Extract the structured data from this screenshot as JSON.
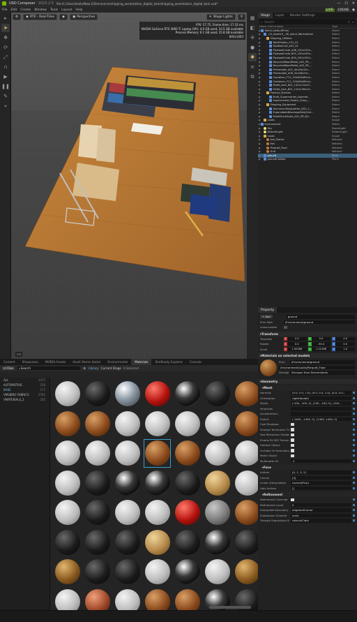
{
  "app": {
    "name": "USD Composer",
    "version": "2023.2.5",
    "file_path": "file:/C:/Users/kallu/New E/Omniverse/shipping_workstation_digital_twin/shipping_workstation_digital_twin.usd*"
  },
  "menu": [
    "File",
    "Edit",
    "Create",
    "Window",
    "Tools",
    "Layout",
    "Help"
  ],
  "menu_status": {
    "live": "LIVE",
    "cache": "CACHE"
  },
  "viewport": {
    "renderer_label": "RTX - Real-Time",
    "camera_label": "Perspective",
    "stage_lights_label": "Stage Lights",
    "hud": [
      "FPS: 57.75, Frame time: 17.32 ms",
      "NVIDIA GeForce RTX 3060 Ti Laptop GPU: 4.6 GB used, 10.5 GB available",
      "Process Memory: 6.1 GB used, 15.8 GB available",
      "843x1403"
    ],
    "footer": "cm"
  },
  "stage": {
    "tabs": [
      "Stage",
      "Layer",
      "Render Settings"
    ],
    "search_placeholder": "Search",
    "columns": [
      "Name (Old to New)",
      "Type"
    ],
    "tree": [
      {
        "name": "World (defaultPrim)",
        "type": "Xform",
        "depth": 0,
        "icon": "xform"
      },
      {
        "name": "_CS_Assets3__5K_stand_Workstation",
        "type": "Xform",
        "depth": 1,
        "icon": "xform"
      },
      {
        "name": "Shipping_Utilities",
        "type": "Xform",
        "depth": 2,
        "icon": "folder"
      },
      {
        "name": "TableTrolley_C01_51",
        "type": "Xform",
        "depth": 3,
        "icon": "xform"
      },
      {
        "name": "ToolBoxCart_A02_51",
        "type": "Xform",
        "depth": 3,
        "icon": "xform"
      },
      {
        "name": "PlywoodCrate_A08_120x120x...",
        "type": "Xform",
        "depth": 3,
        "icon": "xform"
      },
      {
        "name": "PlywoodCrate_B01_100x100x...",
        "type": "Xform",
        "depth": 3,
        "icon": "xform"
      },
      {
        "name": "PlywoodCrate_B04_200x100x...",
        "type": "Xform",
        "depth": 3,
        "icon": "xform"
      },
      {
        "name": "RecycledWoodPallet_A02_PR_...",
        "type": "Xform",
        "depth": 3,
        "icon": "xform"
      },
      {
        "name": "RecycledWoodPallet_A02_PR_...",
        "type": "Xform",
        "depth": 3,
        "icon": "xform"
      },
      {
        "name": "Printerable_A02_40x40x30c...",
        "type": "Xform",
        "depth": 3,
        "icon": "xform"
      },
      {
        "name": "Printerable_A06_32x28x20c...",
        "type": "Xform",
        "depth": 3,
        "icon": "xform"
      },
      {
        "name": "Container_F12_120x80x85cm...",
        "type": "Xform",
        "depth": 3,
        "icon": "xform"
      },
      {
        "name": "Container_F12_120x80x85cm...",
        "type": "Xform",
        "depth": 3,
        "icon": "xform"
      },
      {
        "name": "Pallet_Asm_B01_132x112x47...",
        "type": "Xform",
        "depth": 3,
        "icon": "xform"
      },
      {
        "name": "Pallet_Asm_B01_110x136x15...",
        "type": "Xform",
        "depth": 3,
        "icon": "xform"
      },
      {
        "name": "Product_Shelves",
        "type": "Xform",
        "depth": 2,
        "icon": "folder"
      },
      {
        "name": "Multi_Supermarket_Assemb...",
        "type": "Xform",
        "depth": 3,
        "icon": "xform"
      },
      {
        "name": "Supermarket_Potato_Chips_...",
        "type": "Xform",
        "depth": 3,
        "icon": "xform"
      },
      {
        "name": "Shipping_Equipment",
        "type": "Xform",
        "depth": 2,
        "icon": "folder"
      },
      {
        "name": "AluminumStepLadder_D02_1...",
        "type": "Xform",
        "depth": 3,
        "icon": "xform"
      },
      {
        "name": "ExpandableBeverageDollyCart...",
        "type": "Xform",
        "depth": 3,
        "icon": "xform"
      },
      {
        "name": "PalletTruckScale_A01_PR_NV...",
        "type": "Xform",
        "depth": 3,
        "icon": "xform"
      },
      {
        "name": "Looks",
        "type": "Scope",
        "depth": 1,
        "icon": "folder"
      },
      {
        "name": "Environment",
        "type": "Xform",
        "depth": 0,
        "icon": "xform"
      },
      {
        "name": "Sky",
        "type": "DomeLight",
        "depth": 1,
        "icon": "light"
      },
      {
        "name": "DistantLight",
        "type": "DistantLight",
        "depth": 1,
        "icon": "light"
      },
      {
        "name": "Looks",
        "type": "Scope",
        "depth": 1,
        "icon": "folder"
      },
      {
        "name": "Ash_Planks",
        "type": "Material",
        "depth": 2,
        "icon": "material"
      },
      {
        "name": "Fab",
        "type": "Material",
        "depth": 2,
        "icon": "material"
      },
      {
        "name": "Parquet_Floor",
        "type": "Material",
        "depth": 2,
        "icon": "material"
      },
      {
        "name": "Grid",
        "type": "Material",
        "depth": 2,
        "icon": "material"
      },
      {
        "name": "ground",
        "type": "Mesh",
        "depth": 1,
        "icon": "xform",
        "selected": true
      },
      {
        "name": "groundCollider",
        "type": "Plane",
        "depth": 1,
        "icon": "xform"
      }
    ]
  },
  "property": {
    "tab": "Property",
    "add_label": "Add",
    "name_value": "ground",
    "prim_path_label": "Prim Path",
    "prim_path": "/Environment/ground",
    "instanceable_label": "Instanceable",
    "transform": {
      "title": "Transform",
      "translate_label": "Translate",
      "translate": [
        "0.0",
        "0.0",
        "0.0"
      ],
      "rotate_label": "Rotate",
      "rotate": [
        "0.0",
        "-90.0",
        "0.0"
      ],
      "scale_label": "Scale",
      "scale": [
        "1.00288",
        "1.22168",
        "1.0"
      ]
    },
    "materials": {
      "title": "Materials on selected models",
      "prim_label": "Prim",
      "prim": "/Environment/ground",
      "material": "/Environment/Looks/Parquet_Floor",
      "strength_label": "Strength",
      "strength": "Stronger than Descendants"
    },
    "geometry": {
      "title": "Geometry",
      "mesh_title": "Mesh",
      "rows": [
        {
          "label": "Normals",
          "value": "(0.0, 0.0, 1.0), (0.0, 0.0, 1.0), (0.0, 0.0..."
        },
        {
          "label": "Orientation",
          "value": "rightHanded"
        },
        {
          "label": "Points",
          "value": "(-100, -100, 0), (100, -100, 0), (100..."
        },
        {
          "label": "Velocities",
          "value": ""
        },
        {
          "label": "Accelerations",
          "value": ""
        },
        {
          "label": "Extent",
          "value": "(-1400, -1400, 0), (1400, 1400, 0)"
        },
        {
          "label": "Cast Shadows",
          "value": "check"
        },
        {
          "label": "Shadow Terminator Fix",
          "value": "check"
        },
        {
          "label": "Fast Refraction Shadow",
          "value": "check"
        },
        {
          "label": "Enable Rt SSS Transmission",
          "value": "check"
        },
        {
          "label": "Holdout Object",
          "value": "check"
        },
        {
          "label": "Invisible To Secondary Rays",
          "value": "check"
        },
        {
          "label": "Matte Object",
          "value": "check"
        },
        {
          "label": "Multimatte ID",
          "value": "-1"
        }
      ],
      "face_title": "Face",
      "face_rows": [
        {
          "label": "Indices",
          "value": "[0, 1, 3, 2]"
        },
        {
          "label": "Counts",
          "value": "[4]"
        },
        {
          "label": "Linear Interpolation",
          "value": "cornersPlus1"
        },
        {
          "label": "Hole Indices",
          "value": "[]"
        }
      ],
      "refinement_title": "Refinement",
      "refinement_rows": [
        {
          "label": "Refinement Override",
          "value": "check"
        },
        {
          "label": "Refinement Level",
          "value": "0"
        },
        {
          "label": "Interpolate Boundary",
          "value": "edgeAndCorner"
        },
        {
          "label": "Subdivision Scheme",
          "value": "none"
        },
        {
          "label": "Triangle Subdivision Rule",
          "value": "catmullClark"
        }
      ]
    }
  },
  "content": {
    "tabs": [
      "Content",
      "Showcases",
      "NVIDIA Assets",
      "Asset Stores (beta)",
      "Environments",
      "Materials",
      "SimReady Explorer",
      "Console"
    ],
    "active_tab": "Materials",
    "filter_label": "Files",
    "search_placeholder": "Search",
    "breadcrumb": [
      "Library",
      "Current Stage",
      "0 Selected"
    ],
    "library": [
      {
        "label": "ALL",
        "count": "4472"
      },
      {
        "label": "AUTOMOTIVE",
        "count": "258"
      },
      {
        "label": "BASE",
        "count": "173",
        "selected": true
      },
      {
        "label": "VMSIBRO FABRICS",
        "count": "3785"
      },
      {
        "label": "VMATERIALS_2",
        "count": "256"
      }
    ],
    "materials": [
      "white",
      "black",
      "chrome",
      "red",
      "glass",
      "black",
      "wood",
      "wood",
      "wood",
      "white",
      "white",
      "white",
      "white",
      "wood",
      "white",
      "white",
      "white",
      "wood",
      "wood",
      "white",
      "white",
      "white",
      "black",
      "glass",
      "glass",
      "black",
      "tan",
      "white",
      "white",
      "black",
      "white",
      "white",
      "red",
      "gray",
      "wood",
      "black",
      "black",
      "black",
      "tan",
      "black",
      "glass",
      "black",
      "bronze",
      "black",
      "black",
      "white",
      "glass",
      "white",
      "bronze",
      "white",
      "copper",
      "white",
      "wood",
      "wood",
      "glass",
      "black",
      "black",
      "black",
      "black",
      "black",
      "white",
      "white",
      "black"
    ]
  },
  "colors": {
    "accent": "#3aa0d0",
    "selection": "#3a5f7a",
    "brand": "#76b900"
  }
}
